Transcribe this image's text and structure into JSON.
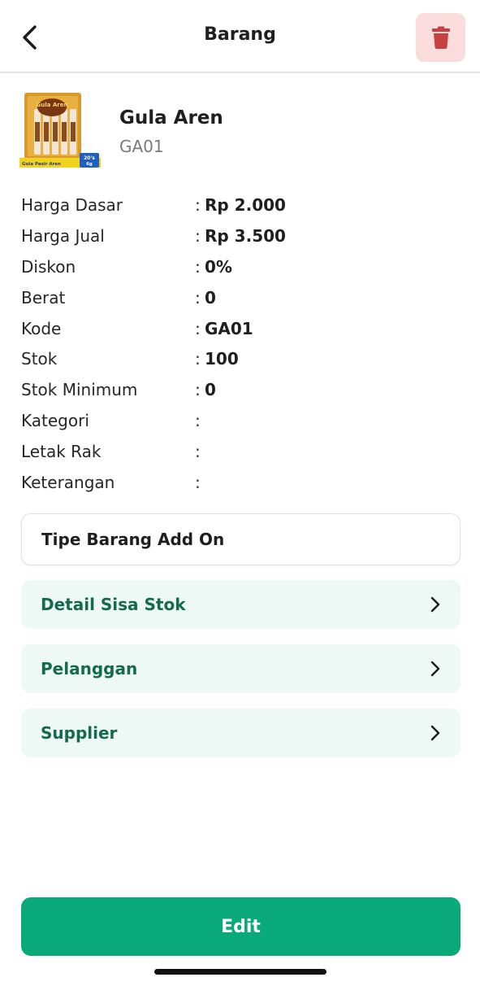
{
  "header": {
    "title": "Barang",
    "back_icon": "chevron-left-icon",
    "delete_icon": "trash-icon",
    "delete_bg_color": "#fbdcdc",
    "delete_icon_color": "#c94040"
  },
  "product": {
    "name": "Gula Aren",
    "code": "GA01",
    "image_text": {
      "brand": "Gula Aren",
      "caption": "Gula Pasir Aren",
      "badge_line1": "20's",
      "badge_line2": "6g"
    }
  },
  "details": [
    {
      "label": "Harga Dasar",
      "sep": ":",
      "value": "Rp 2.000"
    },
    {
      "label": "Harga Jual",
      "sep": ":",
      "value": "Rp 3.500"
    },
    {
      "label": "Diskon",
      "sep": ":",
      "value": "0%"
    },
    {
      "label": "Berat",
      "sep": ":",
      "value": "0"
    },
    {
      "label": "Kode",
      "sep": ":",
      "value": "GA01"
    },
    {
      "label": "Stok",
      "sep": ":",
      "value": "100"
    },
    {
      "label": "Stok Minimum",
      "sep": ":",
      "value": "0"
    },
    {
      "label": "Kategori",
      "sep": ":",
      "value": ""
    },
    {
      "label": "Letak Rak",
      "sep": ":",
      "value": ""
    },
    {
      "label": "Keterangan",
      "sep": ":",
      "value": ""
    }
  ],
  "addon": {
    "label": "Tipe Barang Add On"
  },
  "nav_items": [
    {
      "label": "Detail Sisa Stok",
      "icon": "chevron-right-icon"
    },
    {
      "label": "Pelanggan",
      "icon": "chevron-right-icon"
    },
    {
      "label": "Supplier",
      "icon": "chevron-right-icon"
    }
  ],
  "edit_button": {
    "label": "Edit",
    "color": "#0aa97a"
  },
  "colors": {
    "accent": "#0aa97a",
    "nav_text": "#146b4c",
    "nav_bg": "#eef8f4"
  }
}
